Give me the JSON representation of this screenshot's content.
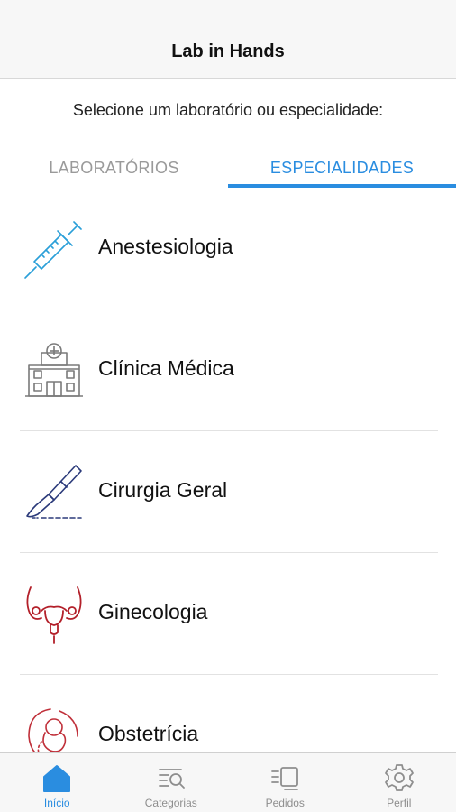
{
  "header": {
    "title": "Lab in Hands"
  },
  "prompt": "Selecione um laboratório ou especialidade:",
  "tabs": [
    {
      "label": "LABORATÓRIOS",
      "active": false
    },
    {
      "label": "ESPECIALIDADES",
      "active": true
    }
  ],
  "specialties": [
    {
      "label": "Anestesiologia",
      "icon": "syringe-icon"
    },
    {
      "label": "Clínica Médica",
      "icon": "hospital-icon"
    },
    {
      "label": "Cirurgia Geral",
      "icon": "scalpel-icon"
    },
    {
      "label": "Ginecologia",
      "icon": "uterus-icon"
    },
    {
      "label": "Obstetrícia",
      "icon": "fetus-icon"
    }
  ],
  "bottom_nav": [
    {
      "label": "Início",
      "icon": "home-icon",
      "active": true
    },
    {
      "label": "Categorias",
      "icon": "categories-search-icon",
      "active": false
    },
    {
      "label": "Pedidos",
      "icon": "orders-icon",
      "active": false
    },
    {
      "label": "Perfil",
      "icon": "gear-icon",
      "active": false
    }
  ],
  "colors": {
    "accent": "#2a8de0",
    "inactive": "#9a9a9a",
    "syringe": "#2a9fd8",
    "hospital": "#7a7a7a",
    "scalpel": "#2b3a7a",
    "uterus": "#b3202a",
    "fetus": "#c0303a"
  }
}
